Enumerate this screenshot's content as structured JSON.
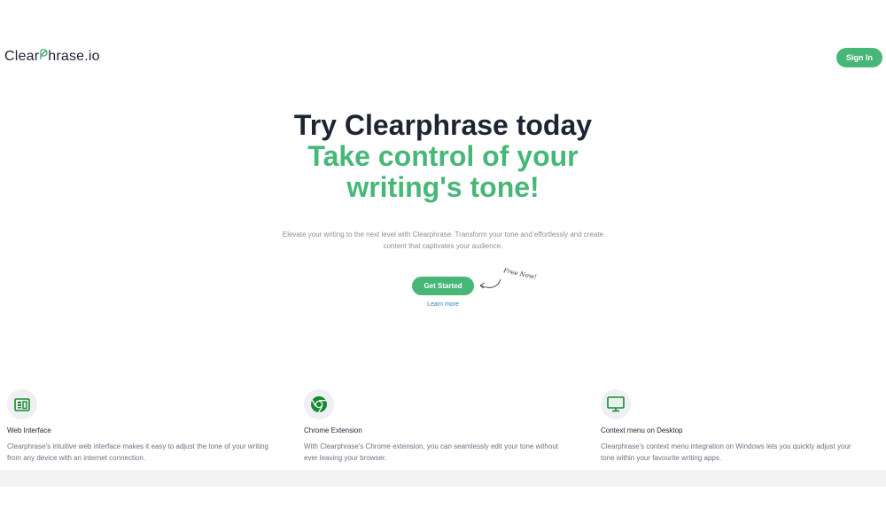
{
  "header": {
    "logo_pre": "Clear",
    "logo_post": "hrase.io",
    "signin_label": "Sign In"
  },
  "hero": {
    "title": "Try Clearphrase today",
    "accent_line1": "Take control of your",
    "accent_line2": "writing's tone!",
    "subtitle_line1": "Elevate your writing to the next level with Clearphrase. Transform your tone and effortlessly and create",
    "subtitle_line2": "content that captivates your audience.",
    "cta_label": "Get Started",
    "free_note": "Free Now!",
    "learn_more": "Learn more"
  },
  "features": [
    {
      "icon": "browser-window-icon",
      "title": "Web Interface",
      "line1": "Clearphrase's intuitive web interface makes it easy to adjust the tone of your writing",
      "line2": "from any device with an internet connection."
    },
    {
      "icon": "chrome-icon",
      "title": "Chrome Extension",
      "line1": "With Clearphrase's Chrome extension, you can seamlessly edit your tone without",
      "line2": "ever leaving your browser."
    },
    {
      "icon": "desktop-monitor-icon",
      "title": "Context menu on Desktop",
      "line1": "Clearphrase's context menu integration on Windows lets you quickly adjust your",
      "line2": "tone within your favourite writing apps."
    }
  ],
  "colors": {
    "brand_green": "#47b778",
    "icon_green": "#168a2e",
    "heading_dark": "#1f2433",
    "link_blue": "#2f7fd0"
  }
}
